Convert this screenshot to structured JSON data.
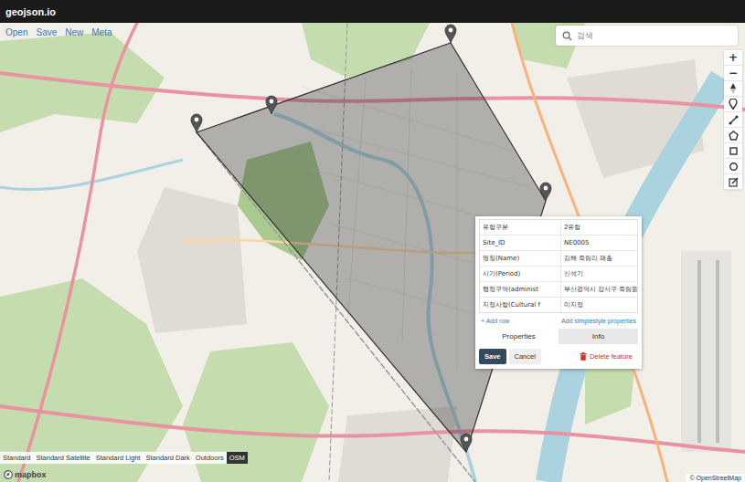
{
  "app": {
    "title": "geojson.io"
  },
  "menu": [
    {
      "label": "Open"
    },
    {
      "label": "Save"
    },
    {
      "label": "New"
    },
    {
      "label": "Meta"
    }
  ],
  "search": {
    "placeholder": "검색"
  },
  "map_controls": {
    "zoom_in": "+",
    "zoom_out": "−"
  },
  "popup": {
    "rows": [
      {
        "key": "유형구분",
        "value": "2유형"
      },
      {
        "key": "Site_ID",
        "value": "NE0005"
      },
      {
        "key": "명칭(Name)",
        "value": "김해 죽림리 패총"
      },
      {
        "key": "시기(Period)",
        "value": "신석기"
      },
      {
        "key": "행정구역(administ",
        "value": "부산광역시 강서구 죽림동"
      },
      {
        "key": "지정사항(Cultural f",
        "value": "미지정"
      }
    ],
    "add_row": "+ Add row",
    "simplestyle": "Add simplestyle properties",
    "tabs": [
      {
        "label": "Properties",
        "selected": true
      },
      {
        "label": "Info",
        "selected": false
      }
    ],
    "buttons": {
      "save": "Save",
      "cancel": "Cancel",
      "delete": "Delete feature"
    }
  },
  "basemaps": [
    {
      "label": "Standard",
      "selected": false
    },
    {
      "label": "Standard Satellite",
      "selected": false
    },
    {
      "label": "Standard Light",
      "selected": false
    },
    {
      "label": "Standard Dark",
      "selected": false
    },
    {
      "label": "Outdoors",
      "selected": false
    },
    {
      "label": "OSM",
      "selected": true
    }
  ],
  "attribution": {
    "logo": "mapbox",
    "credit": "© OpenStreetMap"
  }
}
